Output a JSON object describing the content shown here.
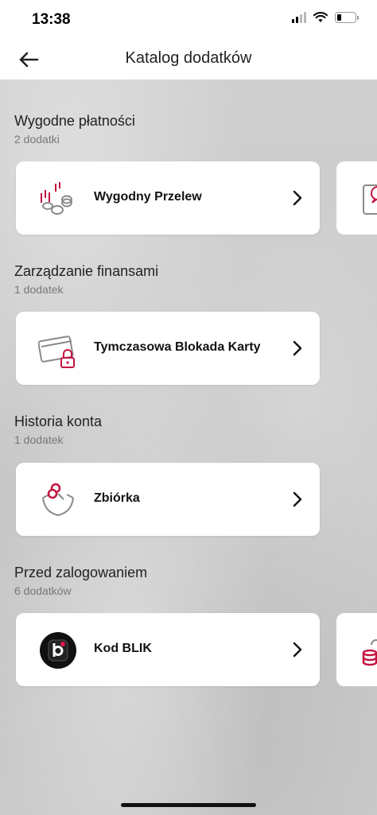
{
  "status": {
    "time": "13:38"
  },
  "nav": {
    "title": "Katalog dodatków"
  },
  "sections": [
    {
      "title": "Wygodne płatności",
      "count": "2 dodatki",
      "card": {
        "label": "Wygodny Przelew",
        "icon": "coins-transfer-icon"
      }
    },
    {
      "title": "Zarządzanie finansami",
      "count": "1 dodatek",
      "card": {
        "label": "Tymczasowa Blokada Karty",
        "icon": "card-lock-icon"
      }
    },
    {
      "title": "Historia konta",
      "count": "1 dodatek",
      "card": {
        "label": "Zbiórka",
        "icon": "collection-bag-icon"
      }
    },
    {
      "title": "Przed zalogowaniem",
      "count": "6 dodatków",
      "card": {
        "label": "Kod BLIK",
        "icon": "blik-logo-icon"
      }
    }
  ],
  "colors": {
    "accent": "#c4123f",
    "icon_gray": "#8a8a8a"
  }
}
